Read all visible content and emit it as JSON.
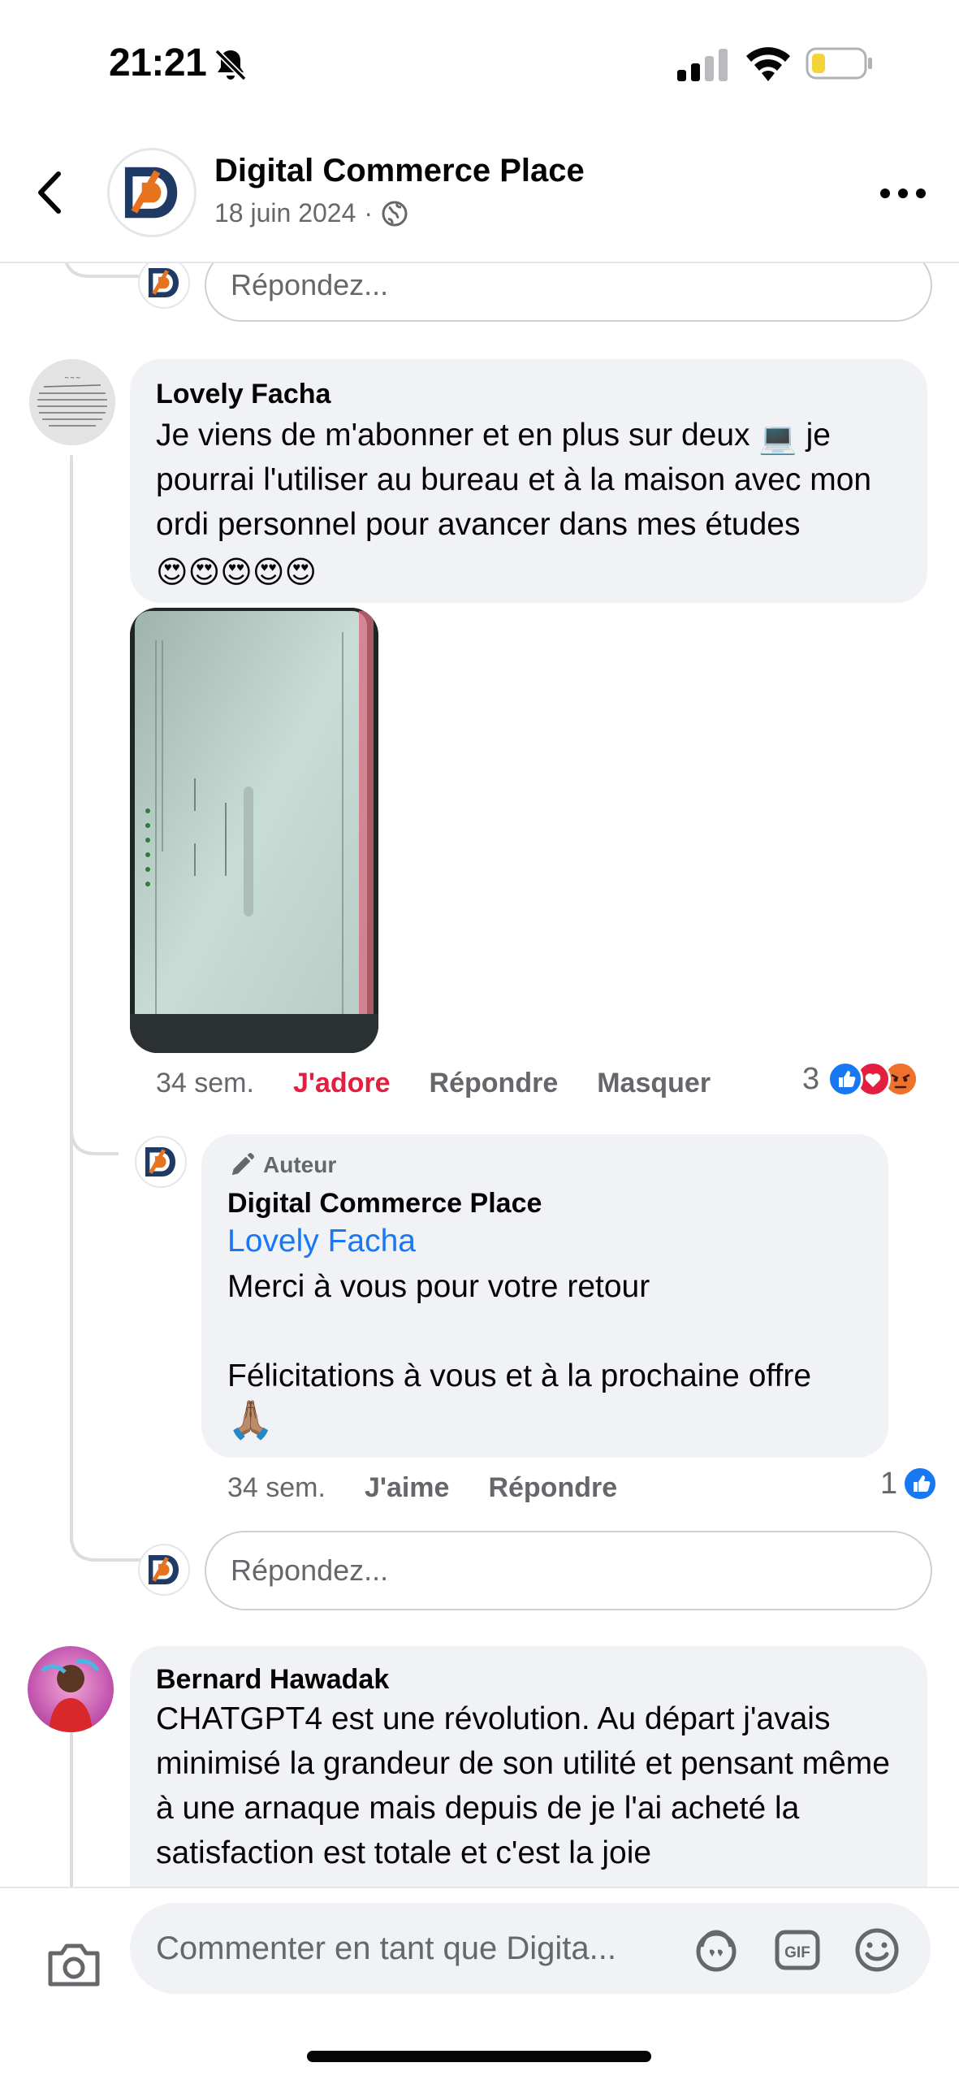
{
  "status_bar": {
    "time": "21:21",
    "icons": [
      "bell-off-icon",
      "signal-icon",
      "wifi-icon",
      "battery-icon"
    ]
  },
  "header": {
    "title": "Digital Commerce Place",
    "date": "18 juin 2024",
    "separator": "·",
    "icons": [
      "back-chevron-icon",
      "globe-icon",
      "more-icon"
    ]
  },
  "reply_placeholder": "Répondez...",
  "comments": [
    {
      "author": "Lovely Facha",
      "text_part1": "Je viens de m'abonner et en plus sur deux",
      "text_emoji1": "💻",
      "text_part2": " je pourrai l'utiliser au bureau et à la maison avec mon ordi personnel pour avancer dans mes études",
      "text_emojis": "😍😍😍😍😍",
      "time": "34 sem.",
      "reaction_label": "J'adore",
      "reply_label": "Répondre",
      "hide_label": "Masquer",
      "reaction_count": "3",
      "reaction_types": [
        "like",
        "love",
        "angry"
      ]
    },
    {
      "badge": "Auteur",
      "author": "Digital Commerce Place",
      "mention": "Lovely Facha",
      "line1": "Merci à vous pour votre retour",
      "line2": "Félicitations à vous et à la prochaine offre",
      "emoji": "🙏🏽",
      "time": "34 sem.",
      "like_label": "J'aime",
      "reply_label": "Répondre",
      "reaction_count": "1",
      "reaction_types": [
        "like"
      ]
    },
    {
      "author": "Bernard Hawadak",
      "text": "CHATGPT4 est une révolution. Au départ j'avais minimisé la grandeur de son utilité et pensant même à une arnaque mais depuis de je l'ai acheté la satisfaction est totale et c'est la joie"
    }
  ],
  "composer": {
    "placeholder": "Commenter en tant que Digita...",
    "icons": [
      "camera-icon",
      "avatar-sticker-icon",
      "gif-icon",
      "smiley-icon"
    ]
  },
  "colors": {
    "accent_blue": "#1877f2",
    "love_red": "#e41e3f",
    "secondary_text": "#65676b",
    "bubble_bg": "#f0f2f5",
    "logo_orange": "#e8731f",
    "logo_navy": "#1f3a64"
  }
}
